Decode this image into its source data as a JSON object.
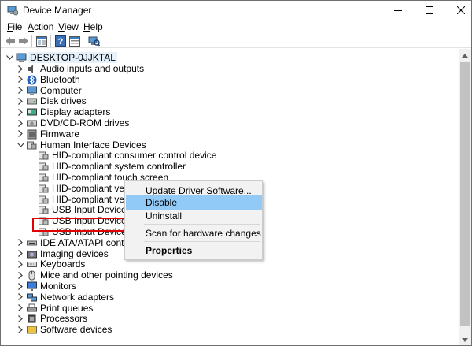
{
  "window": {
    "title": "Device Manager"
  },
  "menu": {
    "file": "File",
    "file_accel": "F",
    "file_rest": "ile",
    "action": "Action",
    "action_accel": "A",
    "action_rest": "ction",
    "view": "View",
    "view_accel": "V",
    "view_rest": "iew",
    "help": "Help",
    "help_accel": "H",
    "help_rest": "elp"
  },
  "toolbar": {
    "icons": [
      "back-icon",
      "forward-icon",
      "show-hide-icon",
      "help-icon",
      "properties-icon",
      "scan-icon"
    ]
  },
  "tree": {
    "root": "DESKTOP-0JJKTAL",
    "items": [
      {
        "label": "Audio inputs and outputs",
        "icon": "speaker-icon",
        "expanded": false
      },
      {
        "label": "Bluetooth",
        "icon": "bluetooth-icon",
        "expanded": false
      },
      {
        "label": "Computer",
        "icon": "computer-icon",
        "expanded": false
      },
      {
        "label": "Disk drives",
        "icon": "disk-icon",
        "expanded": false
      },
      {
        "label": "Display adapters",
        "icon": "display-icon",
        "expanded": false
      },
      {
        "label": "DVD/CD-ROM drives",
        "icon": "dvd-icon",
        "expanded": false
      },
      {
        "label": "Firmware",
        "icon": "firmware-icon",
        "expanded": false
      },
      {
        "label": "Human Interface Devices",
        "icon": "hid-icon",
        "expanded": true
      },
      {
        "label": "IDE ATA/ATAPI controllers",
        "icon": "ide-icon",
        "expanded": false
      },
      {
        "label": "Imaging devices",
        "icon": "camera-icon",
        "expanded": false
      },
      {
        "label": "Keyboards",
        "icon": "keyboard-icon",
        "expanded": false
      },
      {
        "label": "Mice and other pointing devices",
        "icon": "mouse-icon",
        "expanded": false
      },
      {
        "label": "Monitors",
        "icon": "monitor-icon",
        "expanded": false
      },
      {
        "label": "Network adapters",
        "icon": "network-icon",
        "expanded": false
      },
      {
        "label": "Print queues",
        "icon": "printer-icon",
        "expanded": false
      },
      {
        "label": "Processors",
        "icon": "processor-icon",
        "expanded": false
      },
      {
        "label": "Software devices",
        "icon": "software-icon",
        "expanded": false
      }
    ],
    "hid_children": [
      "HID-compliant consumer control device",
      "HID-compliant system controller",
      "HID-compliant touch screen",
      "HID-compliant vendor",
      "HID-compliant vendor",
      "USB Input Device",
      "USB Input Device",
      "USB Input Device"
    ],
    "selected": "HID-compliant touch screen"
  },
  "context_menu": {
    "items": [
      "Update Driver Software...",
      "Disable",
      "Uninstall",
      "Scan for hardware changes",
      "Properties"
    ],
    "highlighted": "Disable",
    "default": "Properties"
  },
  "colors": {
    "highlight": "#91c9f7",
    "annotation": "#e00000"
  }
}
